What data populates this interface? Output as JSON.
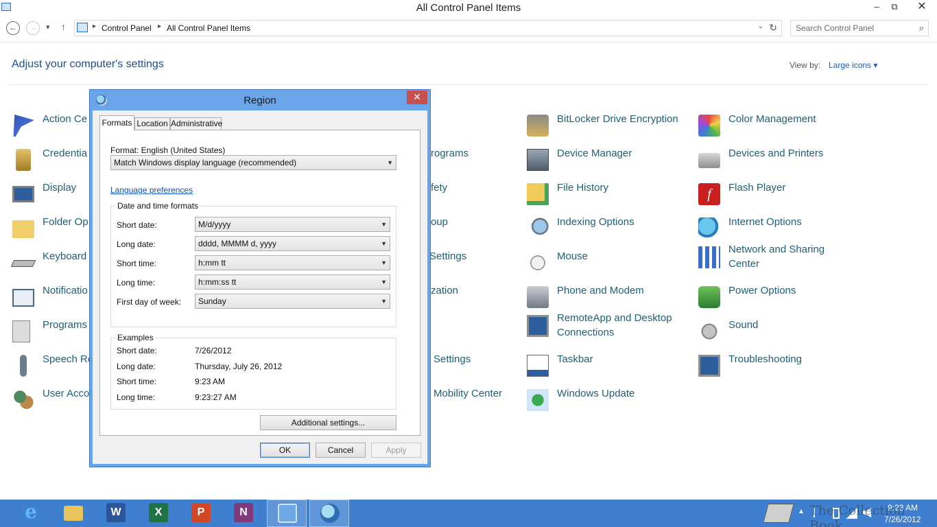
{
  "window": {
    "title": "All Control Panel Items",
    "minimize": "–",
    "restore": "⧉",
    "close": "✕"
  },
  "nav": {
    "back": "←",
    "forward": "→",
    "recent": "▾",
    "up": "↑",
    "crumbs": [
      "Control Panel",
      "All Control Panel Items"
    ],
    "crumb_sep": "▸",
    "address_dropdown": "⌄",
    "refresh": "↻",
    "search_placeholder": "Search Control Panel",
    "search_icon": "⌕"
  },
  "header": {
    "title": "Adjust your computer's settings",
    "view_by_label": "View by:",
    "view_by_value": "Large icons ▾"
  },
  "items": {
    "col1": [
      {
        "label": "Action Ce",
        "icon": "flag-icon"
      },
      {
        "label": "Credentia",
        "icon": "credential-icon"
      },
      {
        "label": "Display",
        "icon": "display-icon"
      },
      {
        "label": "Folder Op",
        "icon": "folder-icon"
      },
      {
        "label": "Keyboard",
        "icon": "keyboard-icon"
      },
      {
        "label": "Notificatio",
        "icon": "notification-icon"
      },
      {
        "label": "Programs",
        "icon": "programs-icon"
      },
      {
        "label": "Speech Re",
        "icon": "microphone-icon"
      },
      {
        "label": "User Acco",
        "icon": "users-icon"
      }
    ],
    "col2_partial": [
      {
        "label": "rograms"
      },
      {
        "label": "fety"
      },
      {
        "label": "oup"
      },
      {
        "label": "Settings"
      },
      {
        "label": "zation"
      },
      {
        "label": "Settings"
      },
      {
        "label": "Mobility Center"
      }
    ],
    "col3": [
      {
        "label": "BitLocker Drive Encryption",
        "icon": "bitlocker-icon"
      },
      {
        "label": "Device Manager",
        "icon": "device-manager-icon"
      },
      {
        "label": "File History",
        "icon": "file-history-icon"
      },
      {
        "label": "Indexing Options",
        "icon": "indexing-icon"
      },
      {
        "label": "Mouse",
        "icon": "mouse-icon"
      },
      {
        "label": "Phone and Modem",
        "icon": "phone-icon"
      },
      {
        "label": "RemoteApp and Desktop Connections",
        "line1": "RemoteApp and Desktop",
        "line2": "Connections",
        "icon": "remoteapp-icon"
      },
      {
        "label": "Taskbar",
        "icon": "taskbar-icon"
      },
      {
        "label": "Windows Update",
        "icon": "windows-update-icon"
      }
    ],
    "col4": [
      {
        "label": "Color Management",
        "icon": "color-management-icon"
      },
      {
        "label": "Devices and Printers",
        "icon": "printer-icon"
      },
      {
        "label": "Flash Player",
        "icon": "flash-icon",
        "glyph": "f"
      },
      {
        "label": "Internet Options",
        "icon": "globe-icon"
      },
      {
        "label": "Network and Sharing Center",
        "line1": "Network and Sharing",
        "line2": "Center",
        "icon": "network-icon"
      },
      {
        "label": "Power Options",
        "icon": "power-icon"
      },
      {
        "label": "Sound",
        "icon": "speaker-icon"
      },
      {
        "label": "Troubleshooting",
        "icon": "troubleshooting-icon"
      }
    ]
  },
  "dialog": {
    "title": "Region",
    "close": "✕",
    "tabs": [
      "Formats",
      "Location",
      "Administrative"
    ],
    "format_label": "Format: English (United States)",
    "format_value": "Match Windows display language (recommended)",
    "language_link": "Language preferences",
    "dt_group_title": "Date and time formats",
    "rows": [
      {
        "label": "Short date:",
        "value": "M/d/yyyy"
      },
      {
        "label": "Long date:",
        "value": "dddd, MMMM d, yyyy"
      },
      {
        "label": "Short time:",
        "value": "h:mm tt"
      },
      {
        "label": "Long time:",
        "value": "h:mm:ss tt"
      },
      {
        "label": "First day of week:",
        "value": "Sunday"
      }
    ],
    "examples_title": "Examples",
    "examples": [
      {
        "label": "Short date:",
        "value": "7/26/2012"
      },
      {
        "label": "Long date:",
        "value": "Thursday, July 26, 2012"
      },
      {
        "label": "Short time:",
        "value": "9:23 AM"
      },
      {
        "label": "Long time:",
        "value": "9:23:27 AM"
      }
    ],
    "additional_settings": "Additional settings...",
    "ok": "OK",
    "cancel": "Cancel",
    "apply": "Apply",
    "combo_arrow": "▼"
  },
  "taskbar": {
    "apps": [
      {
        "name": "internet-explorer",
        "glyph": "e",
        "color": "#2b78d4"
      },
      {
        "name": "file-explorer",
        "glyph": "",
        "color": "#e8c45a"
      },
      {
        "name": "word",
        "glyph": "W",
        "color": "#2b579a"
      },
      {
        "name": "excel",
        "glyph": "X",
        "color": "#217346"
      },
      {
        "name": "powerpoint",
        "glyph": "P",
        "color": "#d24726"
      },
      {
        "name": "onenote",
        "glyph": "N",
        "color": "#80397b"
      },
      {
        "name": "control-panel",
        "glyph": "",
        "color": "#6da8e4"
      },
      {
        "name": "region",
        "glyph": "",
        "color": "#4b8acb"
      }
    ],
    "tray_arrow": "▲",
    "time": "9:23 AM",
    "date": "7/26/2012",
    "watermark": "The Collection Book"
  },
  "colors": {
    "accent": "#3e7fcf",
    "link": "#0b51c2",
    "item_text": "#1f5f76"
  }
}
